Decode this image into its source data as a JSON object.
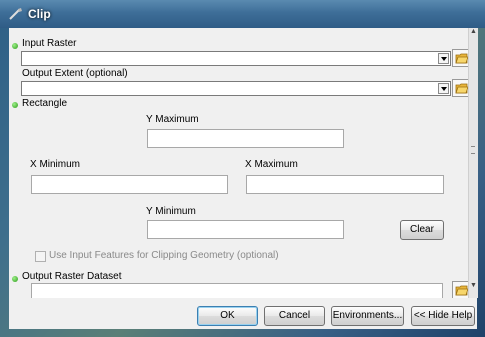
{
  "window": {
    "title": "Clip"
  },
  "form": {
    "input_raster": {
      "label": "Input Raster",
      "value": ""
    },
    "output_extent": {
      "label": "Output Extent (optional)",
      "value": ""
    },
    "rectangle": {
      "label": "Rectangle",
      "y_max_label": "Y Maximum",
      "x_min_label": "X Minimum",
      "x_max_label": "X Maximum",
      "y_min_label": "Y Minimum",
      "clear_label": "Clear"
    },
    "use_input_features": {
      "label": "Use Input Features for Clipping Geometry (optional)",
      "checked": false
    },
    "output_raster": {
      "label": "Output Raster Dataset",
      "value": ""
    }
  },
  "buttons": {
    "ok": "OK",
    "cancel": "Cancel",
    "environments": "Environments...",
    "hide_help": "<< Hide Help"
  },
  "colors": {
    "required_dot": "#3aad22",
    "title_bar": "#3e6e98"
  }
}
